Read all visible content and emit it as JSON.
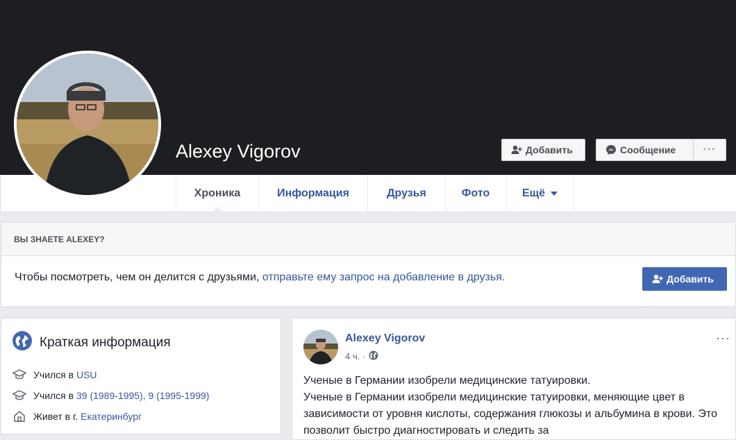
{
  "profile": {
    "name": "Alexey Vigorov"
  },
  "cover_buttons": {
    "add_label": "Добавить",
    "message_label": "Сообщение",
    "more_label": "···"
  },
  "tabs": [
    {
      "label": "Хроника"
    },
    {
      "label": "Информация"
    },
    {
      "label": "Друзья"
    },
    {
      "label": "Фото"
    },
    {
      "label": "Ещё"
    }
  ],
  "know_card": {
    "heading": "ВЫ ЗНАЕТЕ ALEXEY?",
    "text": "Чтобы посмотреть, чем он делится с друзьями,",
    "link": "отправьте ему запрос на добавление в друзья.",
    "button_label": "Добавить"
  },
  "intro": {
    "title": "Краткая информация",
    "rows": [
      {
        "prefix": "Учился в",
        "link": "USU",
        "icon": "graduation-cap-icon"
      },
      {
        "prefix": "Учился в",
        "link": "39 (1989-1995), 9 (1995-1999)",
        "icon": "graduation-cap-icon"
      },
      {
        "prefix": "Живет в г.",
        "link": "Екатеринбург",
        "icon": "home-icon"
      }
    ]
  },
  "post": {
    "author": "Alexey Vigorov",
    "time": "4 ч.",
    "separator": "·",
    "menu": "···",
    "text_line1": "Ученые в Германии изобрели медицинские татуировки.",
    "text_line2": "Ученые в Германии изобрели медицинские татуировки, меняющие цвет в зависимости от уровня кислоты, содержания глюкозы и альбумина в крови. Это позволит быстро диагностировать и следить за"
  },
  "colors": {
    "link": "#365899",
    "primary_button": "#4267b2",
    "cover": "#1c1e21",
    "page_bg": "#e9ebee"
  }
}
